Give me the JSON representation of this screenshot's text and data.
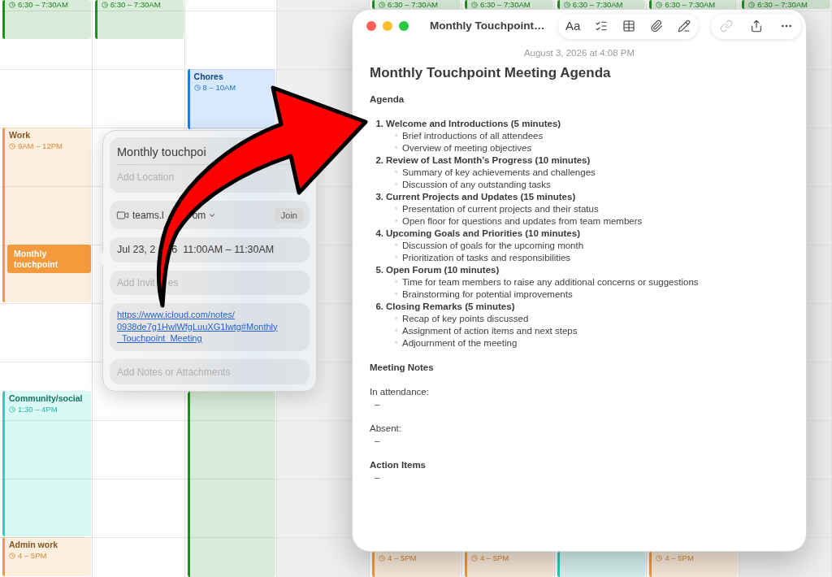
{
  "calendar": {
    "days": [
      {
        "shaded": false
      },
      {
        "shaded": false
      },
      {
        "shaded": false
      },
      {
        "shaded": true
      },
      {
        "shaded": false
      },
      {
        "shaded": false
      },
      {
        "shaded": false
      },
      {
        "shaded": false
      },
      {
        "shaded": true
      }
    ],
    "events": [
      {
        "time": "6:30 – 7:30AM",
        "color": "#1f8f1f",
        "selected": false
      },
      {
        "time": "6:30 – 7:30AM",
        "color": "#1f8f1f",
        "selected": false
      },
      {
        "time": "6:30 – 7:30AM",
        "color": "#1f8f1f",
        "selected": false
      },
      {
        "time": "6:30 – 7:30AM",
        "color": "#1f8f1f",
        "selected": false
      },
      {
        "time": "6:30 – 7:30AM",
        "color": "#1f8f1f",
        "selected": false
      },
      {
        "time": "6:30 – 7:30AM",
        "color": "#1f8f1f",
        "selected": false
      },
      {
        "time": "6:30 – 7:30AM",
        "color": "#1f8f1f",
        "selected": false
      },
      {
        "title": "Chores",
        "time": "8 – 10AM",
        "color": "#1c7ef0",
        "selected": false
      },
      {
        "title": "Work",
        "time": "9AM – 12PM",
        "color": "#f39a3c",
        "selected": false
      },
      {
        "title": "Monthly touchpoint",
        "color": "#f39a3c",
        "selected": true
      },
      {
        "color": "#1f8f1f",
        "selected": false
      },
      {
        "title": "Community/social",
        "time": "1:30 – 4PM",
        "color": "#22d3bd",
        "selected": false
      },
      {
        "title": "Admin work",
        "time": "4 – 5PM",
        "color": "#f39a3c",
        "selected": false
      },
      {
        "time": "4 – 5PM",
        "color": "#f39a3c",
        "selected": false
      },
      {
        "time": "4 – 5PM",
        "color": "#f39a3c",
        "selected": false
      },
      {
        "color": "#22d3bd",
        "selected": false
      },
      {
        "time": "4 – 5PM",
        "color": "#f39a3c",
        "selected": false
      }
    ]
  },
  "popover": {
    "title": "Monthly touchpoi",
    "location": {
      "placeholder": "Add Location"
    },
    "video_call": {
      "parts": [
        "teams.l",
        "om"
      ],
      "button": "Join"
    },
    "date_parts": [
      "Jul 23, 2",
      "6  11:00AM – 11:30AM"
    ],
    "invitees": {
      "placeholder_parts": [
        "Add Invit",
        "es"
      ]
    },
    "link": {
      "lines": [
        "https://www.icloud.com/notes/",
        "0938de7g1HwlWfgLuuXG1lwtg#Monthly",
        "_Touchpoint_Meeting"
      ]
    },
    "notes": {
      "placeholder": "Add Notes or Attachments"
    }
  },
  "notes_window": {
    "title": "Monthly Touchpoint…",
    "toolbar_groups": [
      [
        {
          "kind": "label",
          "label": "Aa",
          "disabled": false
        },
        {
          "kind": "checklist",
          "disabled": false
        },
        {
          "kind": "table",
          "disabled": false
        },
        {
          "kind": "attachment",
          "disabled": false
        },
        {
          "kind": "writing_tools",
          "disabled": false
        }
      ],
      [
        {
          "kind": "collaborate",
          "disabled": true
        },
        {
          "kind": "share",
          "disabled": false
        },
        {
          "kind": "more",
          "disabled": false
        }
      ]
    ],
    "date": "August 3, 2026 at 4:08 PM",
    "heading": "Monthly Touchpoint Meeting Agenda",
    "body": [
      {
        "kind": "heading",
        "text": "Agenda"
      },
      {
        "kind": "list",
        "items": [
          {
            "marker": "1.",
            "text": "Welcome and Introductions (5 minutes)",
            "children": [
              {
                "marker": "◦",
                "text": "Brief introductions of all attendees"
              },
              {
                "marker": "◦",
                "text": "Overview of meeting objectives"
              }
            ]
          },
          {
            "marker": "2.",
            "text": "Review of Last Month’s Progress (10 minutes)",
            "children": [
              {
                "marker": "◦",
                "text": "Summary of key achievements and challenges"
              },
              {
                "marker": "◦",
                "text": "Discussion of any outstanding tasks"
              }
            ]
          },
          {
            "marker": "3.",
            "text": "Current Projects and Updates (15 minutes)",
            "children": [
              {
                "marker": "◦",
                "text": "Presentation of current projects and their status"
              },
              {
                "marker": "◦",
                "text": "Open floor for questions and updates from team members"
              }
            ]
          },
          {
            "marker": "4.",
            "text": "Upcoming Goals and Priorities (10 minutes)",
            "children": [
              {
                "marker": "◦",
                "text": "Discussion of goals for the upcoming month"
              },
              {
                "marker": "◦",
                "text": "Prioritization of tasks and responsibilities"
              }
            ]
          },
          {
            "marker": "5.",
            "text": "Open Forum (10 minutes)",
            "children": [
              {
                "marker": "◦",
                "text": "Time for team members to raise any additional concerns or suggestions"
              },
              {
                "marker": "◦",
                "text": "Brainstorming for potential improvements"
              }
            ]
          },
          {
            "marker": "6.",
            "text": "Closing Remarks (5 minutes)",
            "children": [
              {
                "marker": "◦",
                "text": "Recap of key points discussed"
              },
              {
                "marker": "◦",
                "text": "Assignment of action items and next steps"
              },
              {
                "marker": "◦",
                "text": "Adjournment of the meeting"
              }
            ]
          }
        ]
      },
      {
        "kind": "heading",
        "text": "Meeting Notes"
      },
      {
        "kind": "text",
        "text": "In attendance:",
        "items": [
          {
            "marker": "–"
          }
        ]
      },
      {
        "kind": "text",
        "text": "Absent:",
        "items": [
          {
            "marker": "–"
          }
        ]
      },
      {
        "kind": "heading",
        "text": "Action Items",
        "items": [
          {
            "marker": "–"
          }
        ]
      }
    ]
  }
}
